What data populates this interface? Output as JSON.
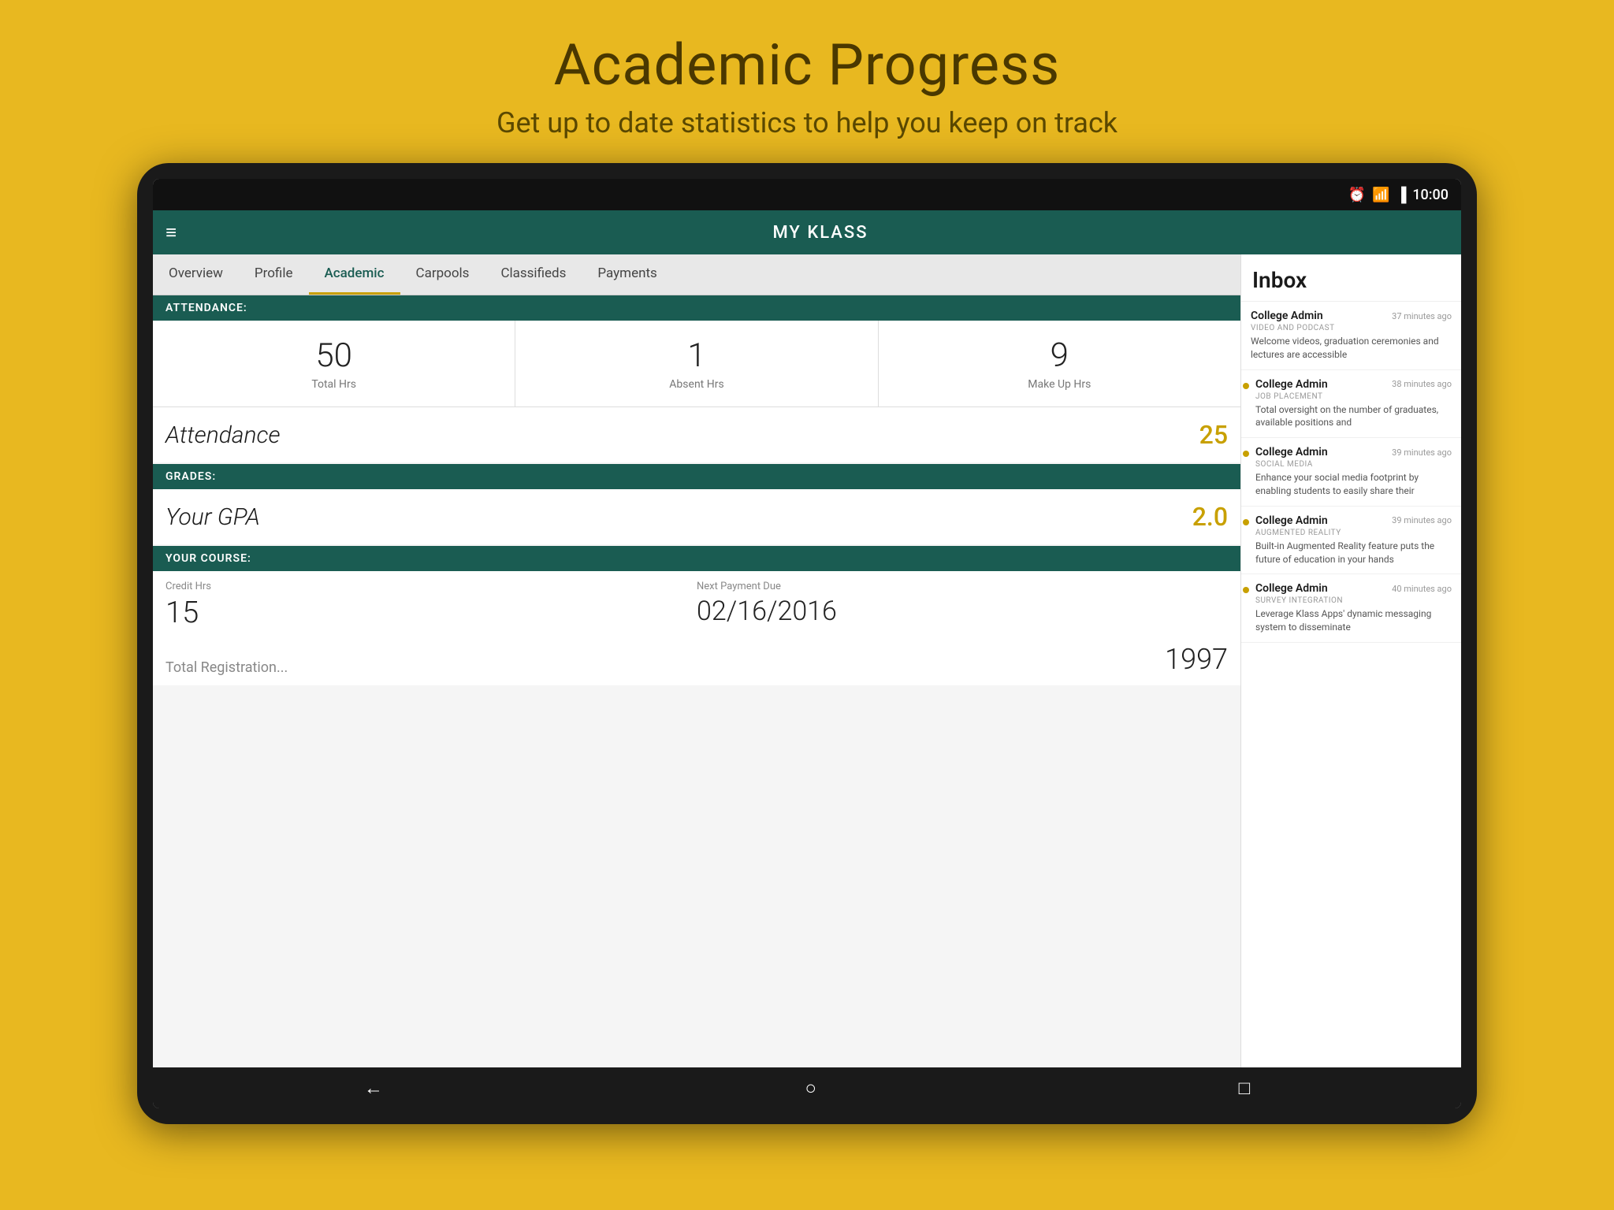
{
  "page": {
    "title": "Academic Progress",
    "subtitle": "Get up to date statistics to help you keep on track"
  },
  "appbar": {
    "title": "MY KLASS",
    "menu_icon": "≡"
  },
  "status_bar": {
    "time": "10:00",
    "icons": [
      "⏰",
      "📶",
      "🔋"
    ]
  },
  "tabs": [
    {
      "label": "Overview",
      "active": false
    },
    {
      "label": "Profile",
      "active": false
    },
    {
      "label": "Academic",
      "active": true
    },
    {
      "label": "Carpools",
      "active": false
    },
    {
      "label": "Classifieds",
      "active": false
    },
    {
      "label": "Payments",
      "active": false
    }
  ],
  "attendance_section": {
    "header": "ATTENDANCE:",
    "stats": [
      {
        "number": "50",
        "label": "Total Hrs"
      },
      {
        "number": "1",
        "label": "Absent Hrs"
      },
      {
        "number": "9",
        "label": "Make Up Hrs"
      }
    ],
    "row_label": "Attendance",
    "row_value": "25"
  },
  "grades_section": {
    "header": "GRADES:",
    "row_label": "Your GPA",
    "row_value": "2.0"
  },
  "course_section": {
    "header": "YOUR COURSE:",
    "credit_hrs_label": "Credit Hrs",
    "credit_hrs_value": "15",
    "next_payment_label": "Next Payment Due",
    "next_payment_value": "02/16/2016",
    "truncated_label": "Total Registration...",
    "truncated_value": "1997"
  },
  "inbox": {
    "title": "Inbox",
    "items": [
      {
        "sender": "College Admin",
        "time": "37 minutes ago",
        "category": "VIDEO AND PODCAST",
        "preview": "Welcome videos, graduation ceremonies and lectures are accessible",
        "has_dot": false
      },
      {
        "sender": "College Admin",
        "time": "38 minutes ago",
        "category": "JOB PLACEMENT",
        "preview": "Total oversight on the number of graduates, available positions and",
        "has_dot": true
      },
      {
        "sender": "College Admin",
        "time": "39 minutes ago",
        "category": "SOCIAL MEDIA",
        "preview": "Enhance your social media footprint by enabling students to easily share their",
        "has_dot": true
      },
      {
        "sender": "College Admin",
        "time": "39 minutes ago",
        "category": "AUGMENTED REALITY",
        "preview": "Built-in Augmented Reality feature puts the future of education in your hands",
        "has_dot": true
      },
      {
        "sender": "College Admin",
        "time": "40 minutes ago",
        "category": "SURVEY INTEGRATION",
        "preview": "Leverage Klass Apps' dynamic messaging system to disseminate",
        "has_dot": true
      }
    ]
  },
  "nav": {
    "back": "←",
    "home": "○",
    "recents": "□"
  }
}
